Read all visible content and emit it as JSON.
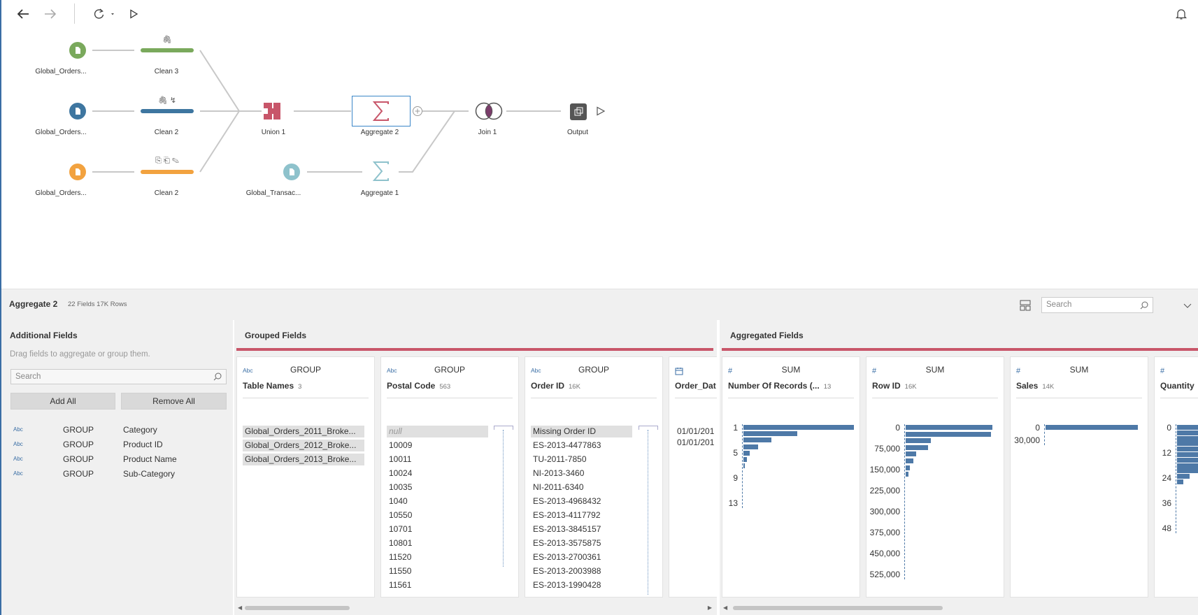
{
  "flow": {
    "nodes": {
      "input1": "Global_Orders...",
      "input2": "Global_Orders...",
      "input3": "Global_Orders...",
      "input4": "Global_Transac...",
      "clean3": "Clean 3",
      "clean2a": "Clean 2",
      "clean2b": "Clean 2",
      "union1": "Union 1",
      "aggregate2": "Aggregate 2",
      "aggregate1": "Aggregate 1",
      "join1": "Join 1",
      "output": "Output"
    },
    "colors": {
      "green": "#7aa95c",
      "blue": "#3e76a0",
      "orange": "#f2a23f",
      "teal": "#8ec2cc",
      "union": "#c8566a",
      "selection": "#3a86c8"
    }
  },
  "profile": {
    "title": "Aggregate 2",
    "meta": "22 Fields  17K Rows",
    "search_placeholder": "Search"
  },
  "additional": {
    "title": "Additional Fields",
    "help": "Drag fields to aggregate or group them.",
    "search_placeholder": "Search",
    "add_all": "Add All",
    "remove_all": "Remove All",
    "fields": [
      {
        "type": "Abc",
        "role": "GROUP",
        "name": "Category"
      },
      {
        "type": "Abc",
        "role": "GROUP",
        "name": "Product ID"
      },
      {
        "type": "Abc",
        "role": "GROUP",
        "name": "Product Name"
      },
      {
        "type": "Abc",
        "role": "GROUP",
        "name": "Sub-Category"
      }
    ]
  },
  "grouped": {
    "title": "Grouped Fields",
    "cards": [
      {
        "type": "Abc",
        "op": "GROUP",
        "name": "Table Names",
        "count": "3",
        "values": [
          "Global_Orders_2011_Broke...",
          "Global_Orders_2012_Broke...",
          "Global_Orders_2013_Broke..."
        ]
      },
      {
        "type": "Abc",
        "op": "GROUP",
        "name": "Postal Code",
        "count": "563",
        "values": [
          "null",
          "10009",
          "10011",
          "10024",
          "10035",
          "1040",
          "10550",
          "10701",
          "10801",
          "11520",
          "11550",
          "11561"
        ]
      },
      {
        "type": "Abc",
        "op": "GROUP",
        "name": "Order ID",
        "count": "16K",
        "values": [
          "Missing Order ID",
          "ES-2013-4477863",
          "TU-2011-7850",
          "NI-2013-3460",
          "NI-2011-6340",
          "ES-2013-4968432",
          "ES-2013-4117792",
          "ES-2013-3845157",
          "ES-2013-3575875",
          "ES-2013-2700361",
          "ES-2013-2003988",
          "ES-2013-1990428"
        ]
      },
      {
        "type": "date-icon",
        "op": "",
        "name": "Order_Dat",
        "count": "",
        "values": [
          "01/01/201",
          "01/01/201"
        ]
      }
    ]
  },
  "aggregated": {
    "title": "Aggregated Fields",
    "cards": [
      {
        "type": "#",
        "op": "SUM",
        "name": "Number Of Records (...",
        "count": "13",
        "axis": [
          "1",
          "5",
          "9",
          "13"
        ],
        "bars": [
          1.0,
          0.49,
          0.25,
          0.13,
          0.06,
          0.03,
          0.015
        ]
      },
      {
        "type": "#",
        "op": "SUM",
        "name": "Row ID",
        "count": "16K",
        "axis": [
          "0",
          "75,000",
          "150,000",
          "225,000",
          "300,000",
          "375,000",
          "450,000",
          "525,000"
        ],
        "bars": [
          1.0,
          0.98,
          0.29,
          0.26,
          0.12,
          0.09,
          0.05,
          0.03
        ]
      },
      {
        "type": "#",
        "op": "SUM",
        "name": "Sales",
        "count": "14K",
        "axis": [
          "0",
          "30,000"
        ],
        "bars": [
          1.0
        ]
      },
      {
        "type": "#",
        "op": "",
        "name": "Quantity",
        "count": "",
        "axis": [
          "0",
          "12",
          "24",
          "36",
          "48"
        ],
        "bars": [
          1.0,
          1.0,
          1.0,
          1.0,
          0.9,
          0.75,
          0.55,
          0.4,
          0.25,
          0.12,
          0.06
        ]
      }
    ]
  }
}
